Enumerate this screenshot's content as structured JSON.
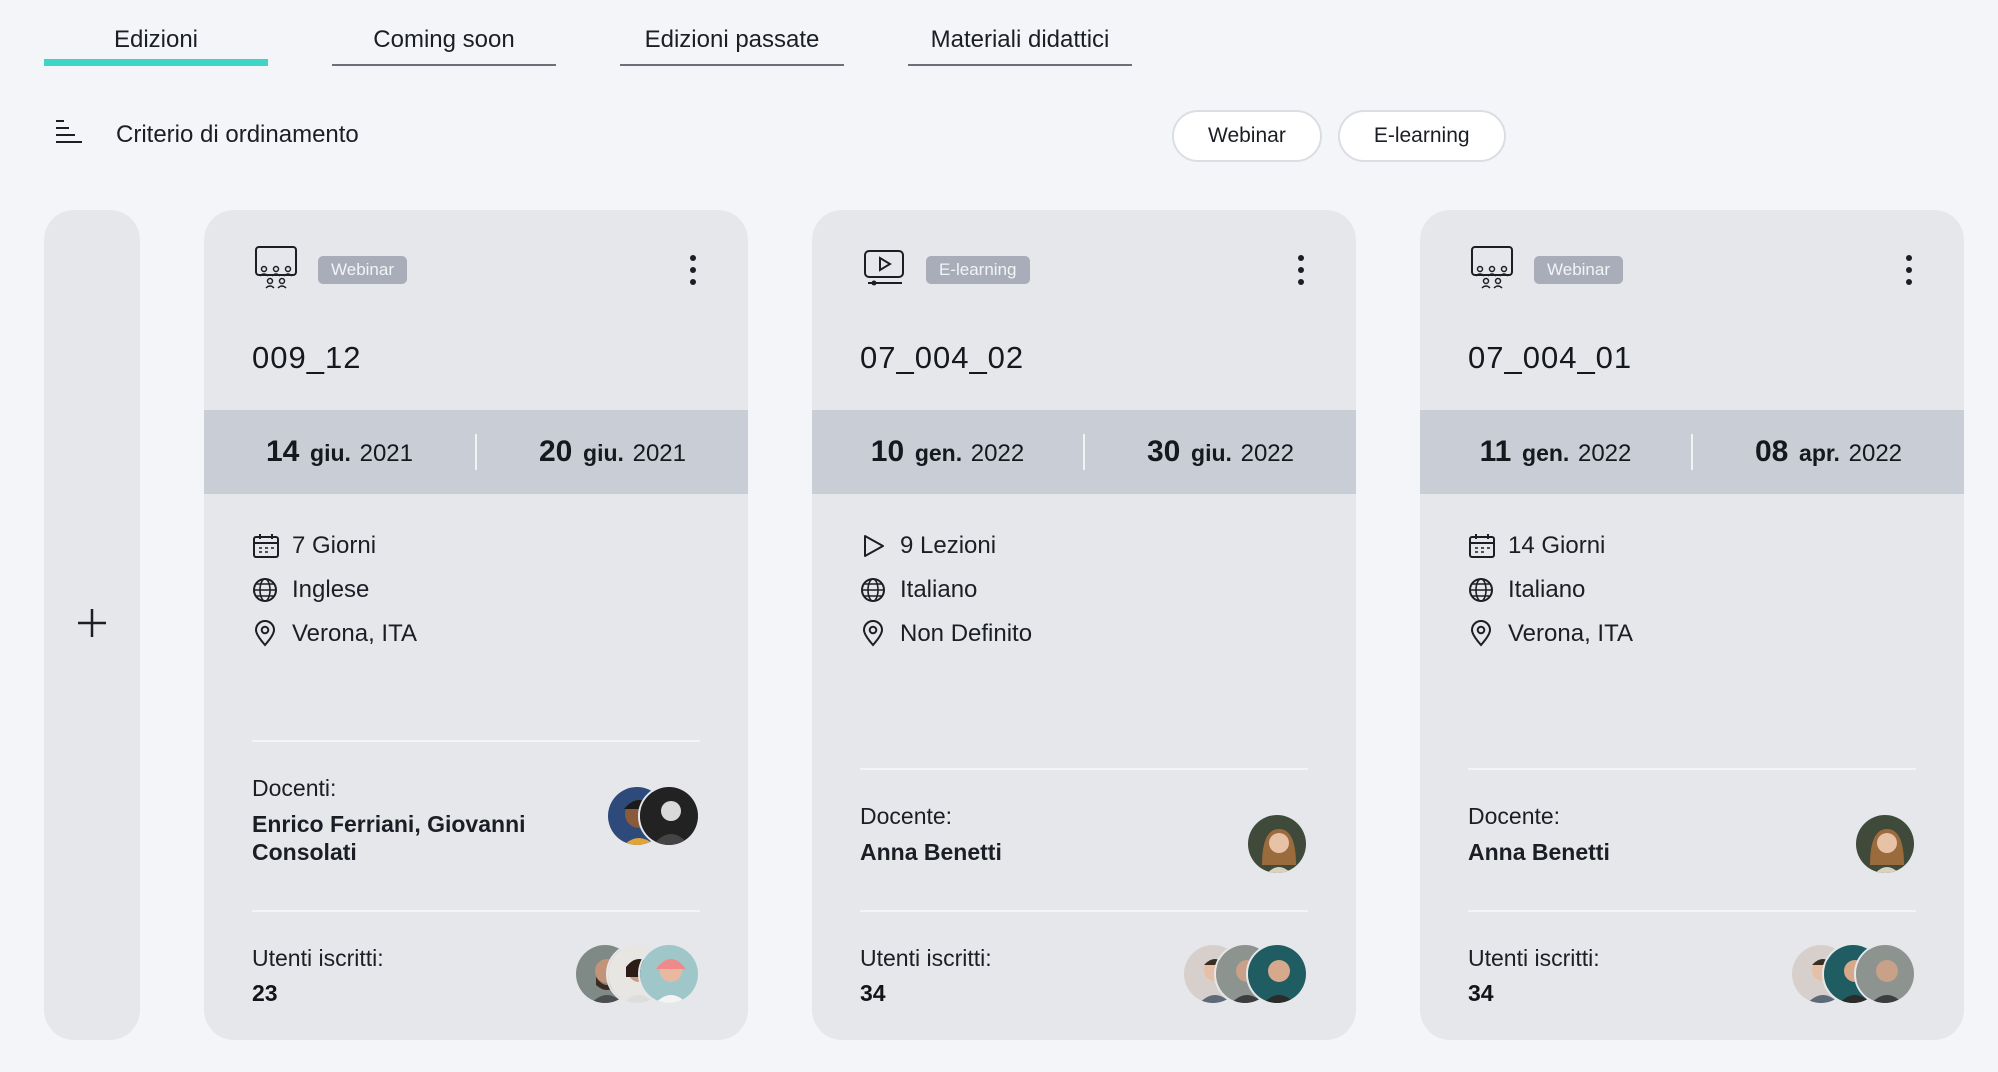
{
  "tabs": [
    {
      "label": "Edizioni",
      "active": true
    },
    {
      "label": "Coming soon",
      "active": false
    },
    {
      "label": "Edizioni passate",
      "active": false
    },
    {
      "label": "Materiali didattici",
      "active": false
    }
  ],
  "sort": {
    "label": "Criterio di ordinamento",
    "icon": "sort-icon"
  },
  "filters": [
    {
      "label": "Webinar"
    },
    {
      "label": "E-learning"
    }
  ],
  "add_button": {
    "icon": "plus-icon"
  },
  "colors": {
    "accent": "#3bd6c6",
    "card_bg": "#e6e7eb",
    "date_band": "#c9cdd6",
    "badge": "#a8adb9"
  },
  "cards": [
    {
      "type": "Webinar",
      "type_icon": "webinar-icon",
      "title": "009_12",
      "start": {
        "day": "14",
        "month": "giu.",
        "year": "2021"
      },
      "end": {
        "day": "20",
        "month": "giu.",
        "year": "2021"
      },
      "info": [
        {
          "icon": "calendar-icon",
          "text": "7 Giorni"
        },
        {
          "icon": "globe-icon",
          "text": "Inglese"
        },
        {
          "icon": "location-pin-icon",
          "text": "Verona, ITA"
        }
      ],
      "teachers_label": "Docenti:",
      "teachers": "Enrico Ferriani, Giovanni Consolati",
      "users_label": "Utenti iscritti:",
      "users_count": "23"
    },
    {
      "type": "E-learning",
      "type_icon": "video-play-icon",
      "title": "07_004_02",
      "start": {
        "day": "10",
        "month": "gen.",
        "year": "2022"
      },
      "end": {
        "day": "30",
        "month": "giu.",
        "year": "2022"
      },
      "info": [
        {
          "icon": "play-icon",
          "text": "9 Lezioni"
        },
        {
          "icon": "globe-icon",
          "text": "Italiano"
        },
        {
          "icon": "location-pin-icon",
          "text": "Non Definito"
        }
      ],
      "teachers_label": "Docente:",
      "teachers": "Anna Benetti",
      "users_label": "Utenti iscritti:",
      "users_count": "34"
    },
    {
      "type": "Webinar",
      "type_icon": "webinar-icon",
      "title": "07_004_01",
      "start": {
        "day": "11",
        "month": "gen.",
        "year": "2022"
      },
      "end": {
        "day": "08",
        "month": "apr.",
        "year": "2022"
      },
      "info": [
        {
          "icon": "calendar-icon",
          "text": "14 Giorni"
        },
        {
          "icon": "globe-icon",
          "text": "Italiano"
        },
        {
          "icon": "location-pin-icon",
          "text": "Verona, ITA"
        }
      ],
      "teachers_label": "Docente:",
      "teachers": "Anna Benetti",
      "users_label": "Utenti iscritti:",
      "users_count": "34"
    }
  ]
}
